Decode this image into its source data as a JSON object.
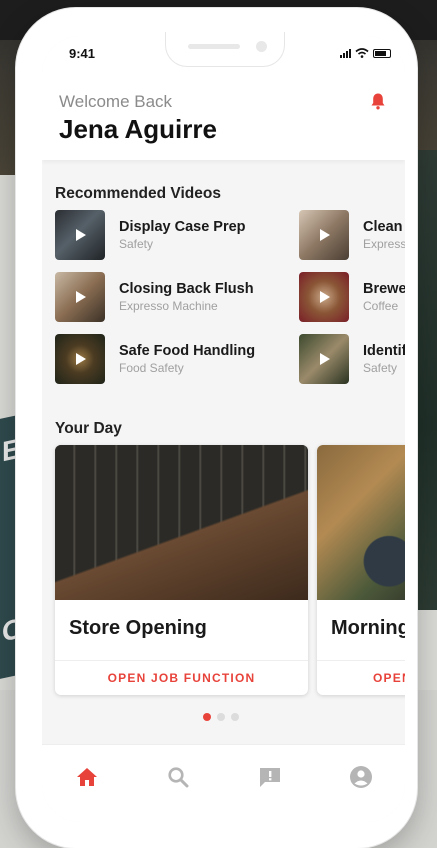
{
  "status_bar": {
    "time": "9:41"
  },
  "header": {
    "welcome": "Welcome Back",
    "user_name": "Jena Aguirre"
  },
  "recommended": {
    "title": "Recommended Videos",
    "videos": [
      {
        "title": "Display Case Prep",
        "category": "Safety"
      },
      {
        "title": "Closing Back Flush",
        "category": "Expresso Machine"
      },
      {
        "title": "Safe Food Handling",
        "category": "Food Safety"
      },
      {
        "title": "Clean",
        "category": "Express"
      },
      {
        "title": "Brewe",
        "category": "Coffee"
      },
      {
        "title": "Identif",
        "category": "Safety"
      }
    ]
  },
  "your_day": {
    "title": "Your Day",
    "cards": [
      {
        "title": "Store Opening",
        "action": "OPEN JOB FUNCTION"
      },
      {
        "title": "Morning",
        "action": "OPEN"
      }
    ],
    "pagination": {
      "count": 3,
      "active": 1
    }
  },
  "tabs": [
    {
      "icon": "home-icon",
      "active": true
    },
    {
      "icon": "search-icon",
      "active": false
    },
    {
      "icon": "feedback-icon",
      "active": false
    },
    {
      "icon": "account-icon",
      "active": false
    }
  ],
  "colors": {
    "accent": "#e8433b",
    "inactive_icon": "#b5b5b5"
  },
  "background": {
    "badge_letters": [
      "E",
      "O"
    ]
  }
}
